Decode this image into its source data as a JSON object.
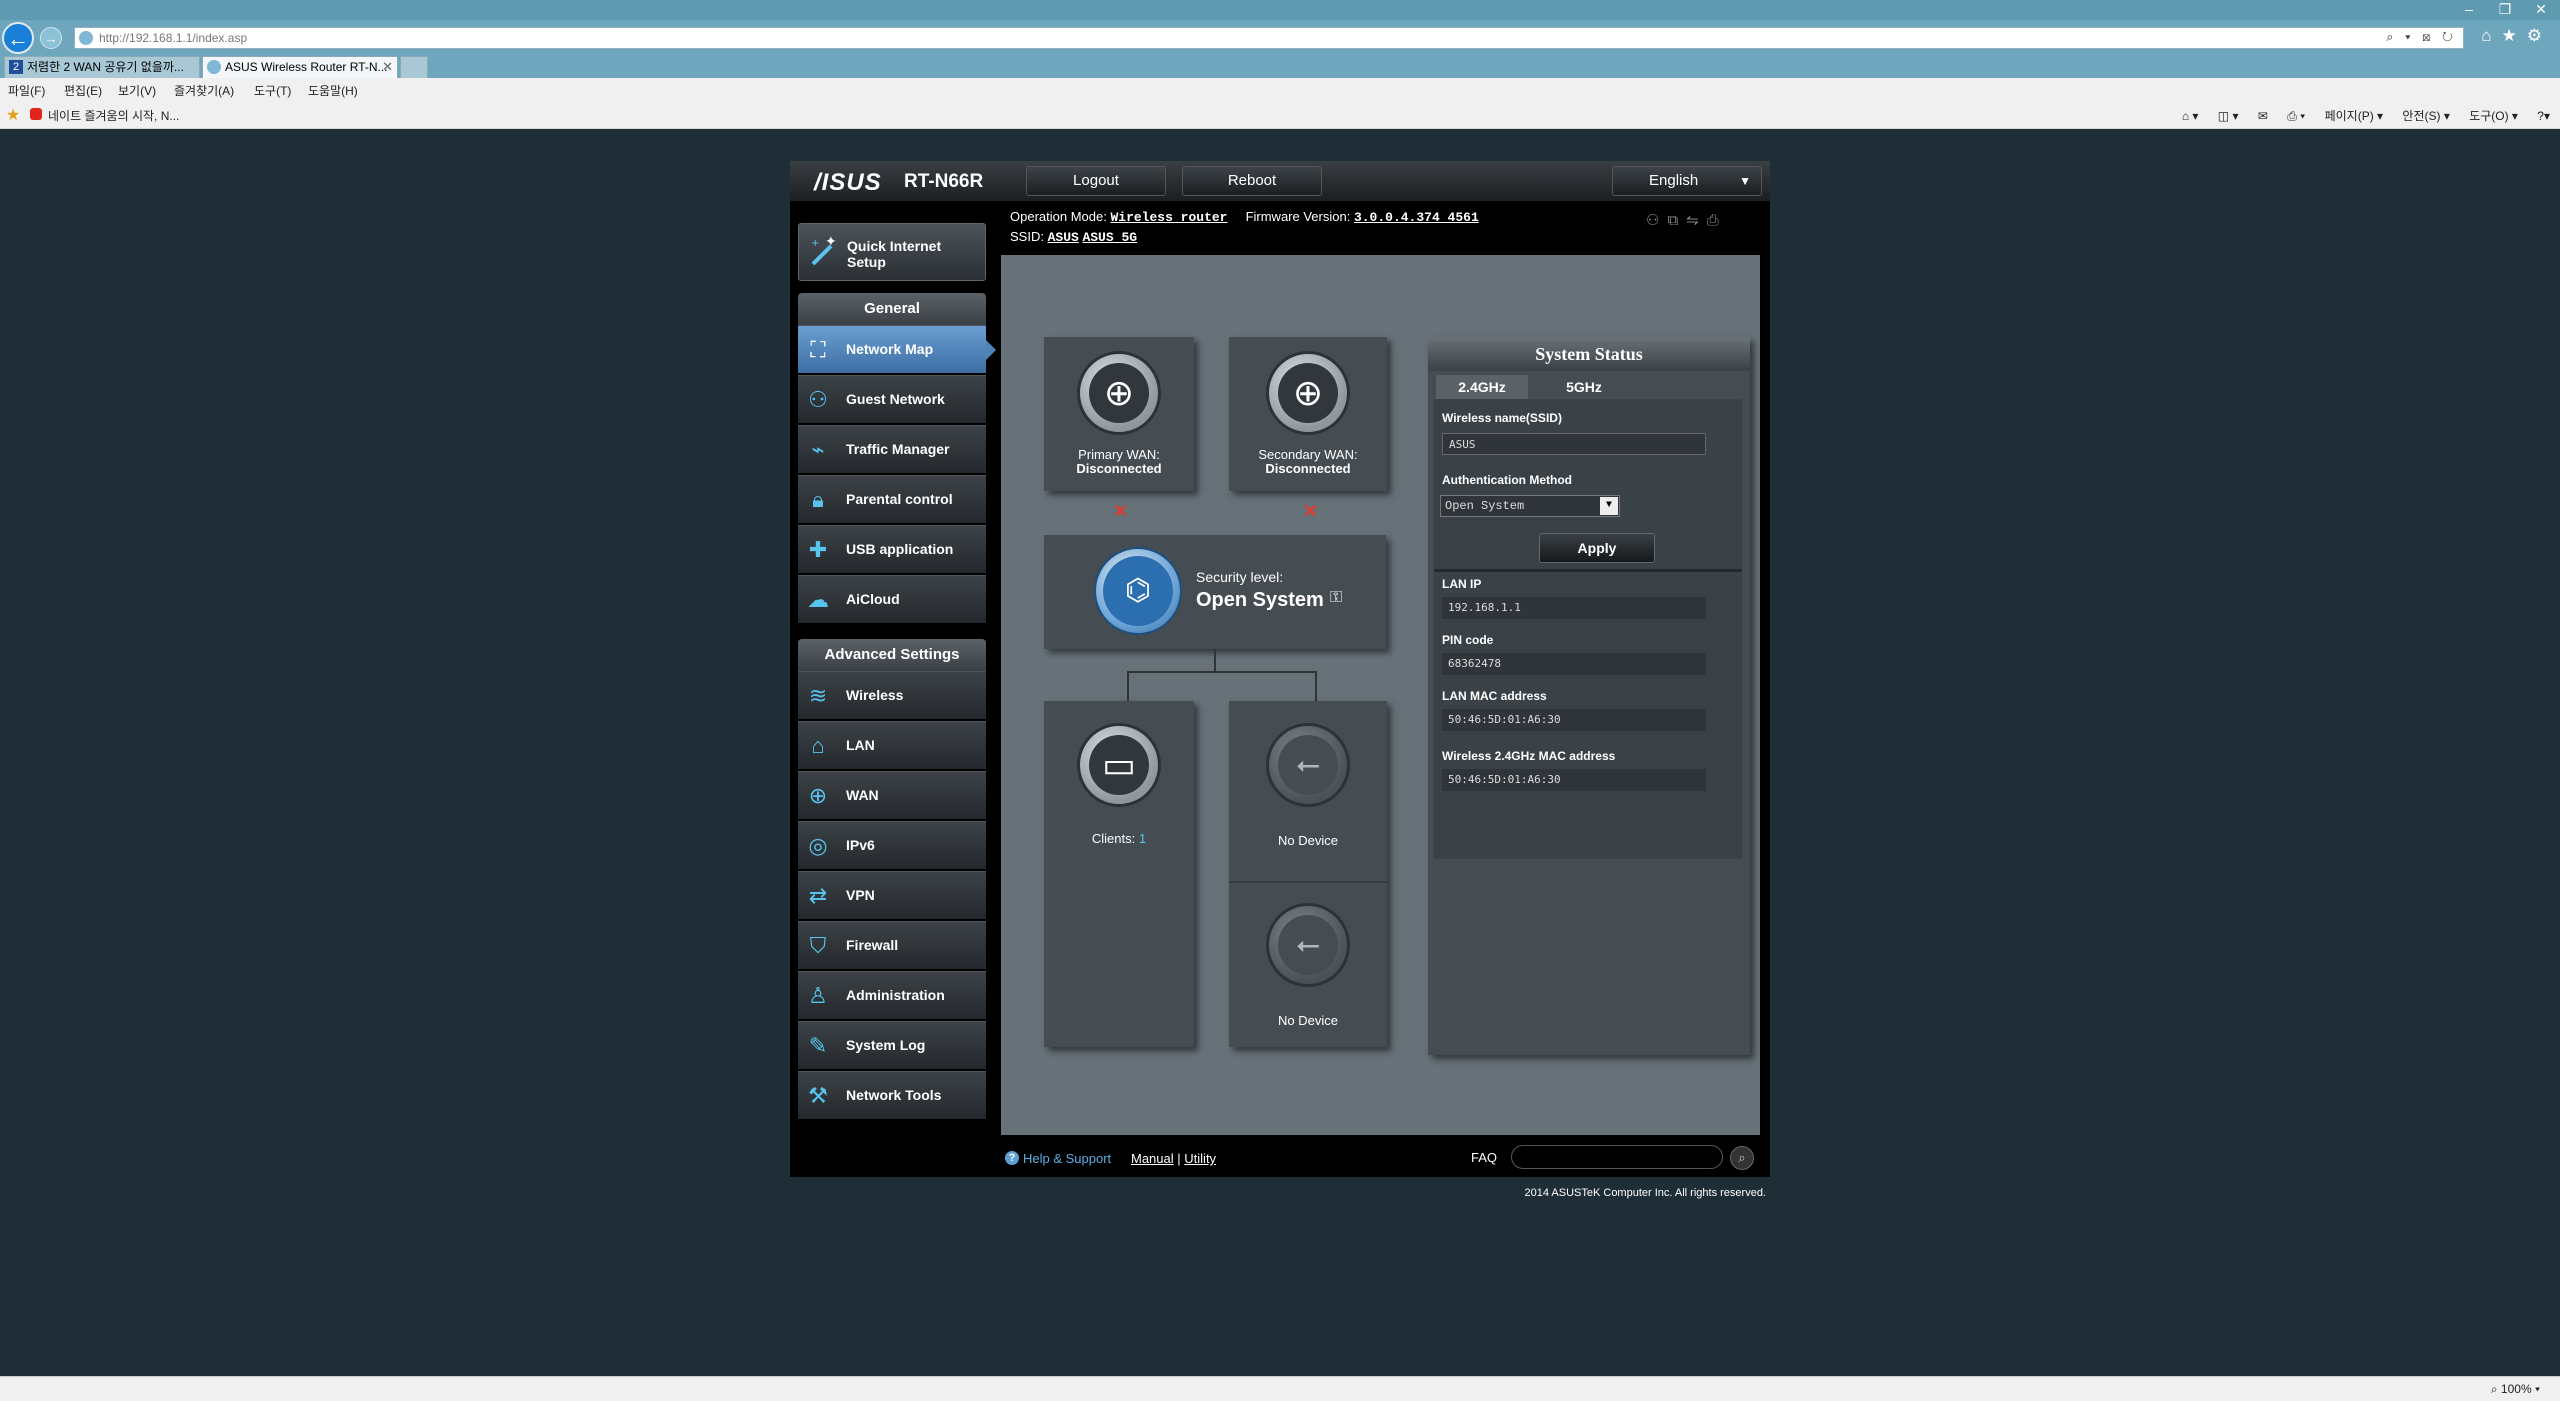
{
  "browser": {
    "url": "http://192.168.1.1/index.asp",
    "tabs": [
      {
        "label": "저렴한 2 WAN 공유기 없을까..."
      },
      {
        "label": "ASUS Wireless Router RT-N..."
      }
    ],
    "menu": [
      "파일(F)",
      "편집(E)",
      "보기(V)",
      "즐겨찾기(A)",
      "도구(T)",
      "도움말(H)"
    ],
    "favorites_link": "네이트  즐겨움의 시작, N...",
    "command_items": [
      "페이지(P) ▾",
      "안전(S) ▾",
      "도구(O) ▾"
    ],
    "zoom": "100%"
  },
  "router": {
    "logo": "/ISUS",
    "model": "RT-N66R",
    "logout_label": "Logout",
    "reboot_label": "Reboot",
    "language": "English",
    "operation_mode_label": "Operation Mode:",
    "operation_mode": "Wireless router",
    "firmware_label": "Firmware Version:",
    "firmware": "3.0.0.4.374_4561",
    "ssid_label": "SSID:",
    "ssid_1": "ASUS",
    "ssid_2": "ASUS_5G"
  },
  "sidebar": {
    "qis_label": "Quick Internet Setup",
    "general_header": "General",
    "general_items": [
      {
        "label": "Network Map",
        "icon": "network-map-icon"
      },
      {
        "label": "Guest Network",
        "icon": "guest-network-icon"
      },
      {
        "label": "Traffic Manager",
        "icon": "traffic-manager-icon"
      },
      {
        "label": "Parental control",
        "icon": "lock-icon"
      },
      {
        "label": "USB application",
        "icon": "puzzle-icon"
      },
      {
        "label": "AiCloud",
        "icon": "cloud-icon"
      }
    ],
    "advanced_header": "Advanced Settings",
    "advanced_items": [
      {
        "label": "Wireless",
        "icon": "wireless-icon"
      },
      {
        "label": "LAN",
        "icon": "home-icon"
      },
      {
        "label": "WAN",
        "icon": "globe-icon"
      },
      {
        "label": "IPv6",
        "icon": "ipv6-icon"
      },
      {
        "label": "VPN",
        "icon": "vpn-icon"
      },
      {
        "label": "Firewall",
        "icon": "shield-icon"
      },
      {
        "label": "Administration",
        "icon": "user-icon"
      },
      {
        "label": "System Log",
        "icon": "edit-icon"
      },
      {
        "label": "Network Tools",
        "icon": "wrench-icon"
      }
    ]
  },
  "network_map": {
    "primary_wan_label": "Primary WAN:",
    "primary_wan_status": "Disconnected",
    "secondary_wan_label": "Secondary WAN:",
    "secondary_wan_status": "Disconnected",
    "security_label": "Security level:",
    "security_value": "Open System",
    "clients_label": "Clients:",
    "clients_count": "1",
    "usb1_status": "No Device",
    "usb2_status": "No Device"
  },
  "system_status": {
    "title": "System Status",
    "tab_24": "2.4GHz",
    "tab_5": "5GHz",
    "ssid_label": "Wireless name(SSID)",
    "ssid_value": "ASUS",
    "auth_label": "Authentication Method",
    "auth_value": "Open System",
    "apply_label": "Apply",
    "lan_ip_label": "LAN IP",
    "lan_ip": "192.168.1.1",
    "pin_label": "PIN code",
    "pin": "68362478",
    "lan_mac_label": "LAN MAC address",
    "lan_mac": "50:46:5D:01:A6:30",
    "wl_mac_label": "Wireless 2.4GHz MAC address",
    "wl_mac": "50:46:5D:01:A6:30"
  },
  "footer": {
    "help_label": "Help & Support",
    "manual_label": "Manual",
    "separator": "|",
    "utility_label": "Utility",
    "faq_label": "FAQ",
    "copyright": "2014 ASUSTeK Computer Inc. All rights reserved."
  }
}
